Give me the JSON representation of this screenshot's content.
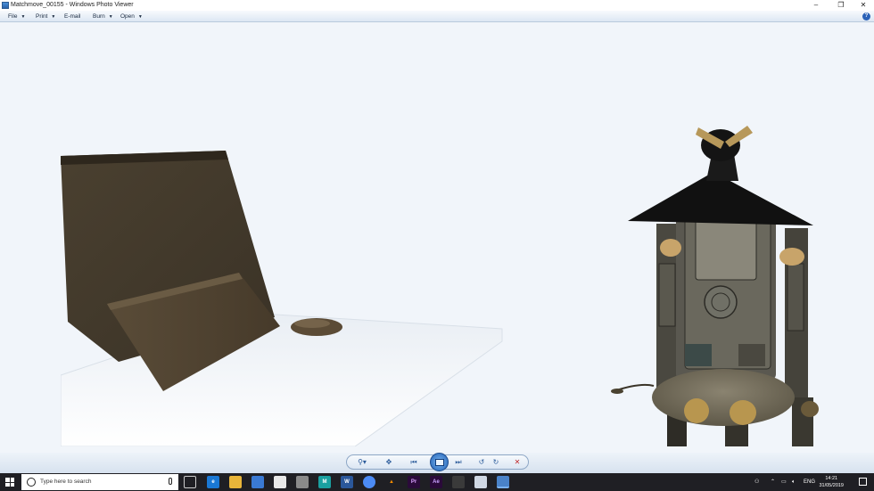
{
  "window": {
    "title": "Matchmove_00155 - Windows Photo Viewer",
    "controls": {
      "minimize": "–",
      "maximize": "❐",
      "close": "✕"
    }
  },
  "menubar": {
    "items": [
      {
        "label": "File",
        "has_dropdown": true
      },
      {
        "label": "Print",
        "has_dropdown": true
      },
      {
        "label": "E-mail",
        "has_dropdown": false
      },
      {
        "label": "Burn",
        "has_dropdown": true
      },
      {
        "label": "Open",
        "has_dropdown": true
      }
    ],
    "help_icon": "?"
  },
  "controlbar": {
    "icons": [
      "zoom-icon",
      "actual-size-icon",
      "previous-icon",
      "slideshow-icon",
      "next-icon",
      "rotate-left-icon",
      "rotate-right-icon",
      "delete-icon"
    ]
  },
  "taskbar": {
    "search_placeholder": "Type here to search",
    "apps": [
      "task-view",
      "edge",
      "file-explorer",
      "store",
      "mail",
      "app",
      "maya",
      "word",
      "chrome",
      "vlc",
      "premiere",
      "after-effects",
      "photos",
      "paint",
      "photo-viewer"
    ],
    "tray": {
      "language": "ENG",
      "time": "14:21",
      "date": "31/05/2019"
    }
  },
  "colors": {
    "viewer_bg": "#f1f5fa",
    "taskbar_bg": "#1f1f24",
    "accent": "#2b62b8"
  }
}
